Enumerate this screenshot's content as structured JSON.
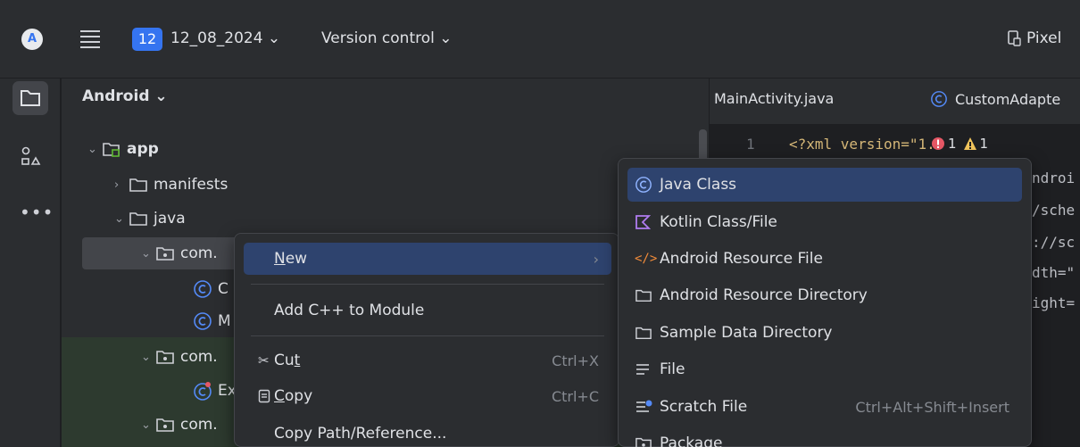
{
  "titlebar": {
    "logo": "A",
    "project_badge": "12",
    "project_name": "12_08_2024 ⌄",
    "vcs_label": "Version control ⌄",
    "device": "Pixel"
  },
  "project_panel": {
    "title": "Android ⌄",
    "tree": [
      {
        "chev": "⌄",
        "label": "app"
      },
      {
        "chev": "›",
        "label": "manifests"
      },
      {
        "chev": "⌄",
        "label": "java"
      },
      {
        "chev": "⌄",
        "label": "com."
      },
      {
        "chev": "",
        "label": "C"
      },
      {
        "chev": "",
        "label": "M"
      },
      {
        "chev": "⌄",
        "label": "com."
      },
      {
        "chev": "",
        "label": "Ex"
      },
      {
        "chev": "⌄",
        "label": "com."
      }
    ]
  },
  "editor": {
    "tabs": [
      "MainActivity.java",
      "CustomAdapte"
    ],
    "line_number": "1",
    "code_lines": [
      "<?xml version=\"1.",
      "ndroi",
      "/sche",
      "://sc",
      "dth=\"",
      "ight="
    ],
    "inspection": {
      "errors": "1",
      "warnings": "1"
    }
  },
  "context_menu": {
    "new": {
      "label_u": "N",
      "label_rest": "ew",
      "arrow": "›"
    },
    "add_cpp": "Add C++ to Module",
    "cut": {
      "label_pre": "Cu",
      "label_u": "t",
      "shortcut": "Ctrl+X"
    },
    "copy": {
      "label_u": "C",
      "label_rest": "opy",
      "shortcut": "Ctrl+C"
    },
    "copy_path": "Copy Path/Reference..."
  },
  "new_submenu": {
    "items": [
      {
        "label": "Java Class",
        "shortcut": ""
      },
      {
        "label": "Kotlin Class/File",
        "shortcut": ""
      },
      {
        "label": "Android Resource File",
        "shortcut": ""
      },
      {
        "label": "Android Resource Directory",
        "shortcut": ""
      },
      {
        "label": "Sample Data Directory",
        "shortcut": ""
      },
      {
        "label": "File",
        "shortcut": ""
      },
      {
        "label": "Scratch File",
        "shortcut": "Ctrl+Alt+Shift+Insert"
      },
      {
        "label": "Package",
        "shortcut": ""
      }
    ]
  },
  "colors": {
    "accent": "#3574f0",
    "selection": "#2e436e",
    "panel_bg": "#2b2d30",
    "editor_bg": "#1e1f22"
  }
}
